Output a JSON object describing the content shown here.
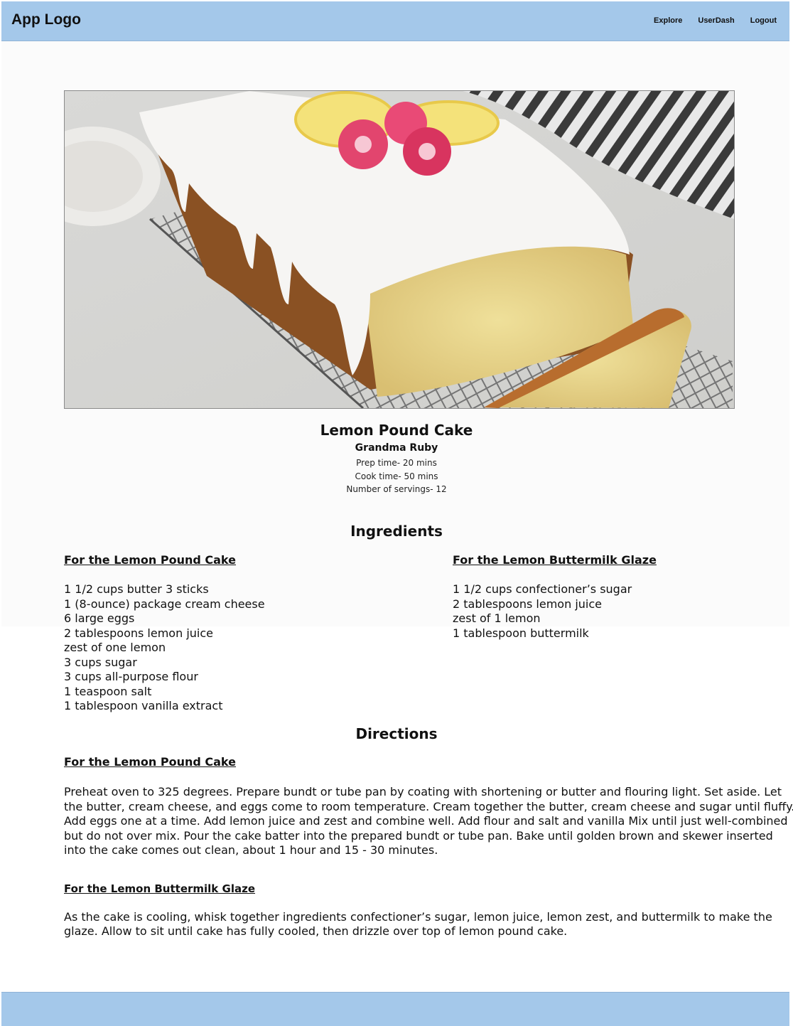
{
  "header": {
    "logo": "App Logo",
    "nav": [
      "Explore",
      "UserDash",
      "Logout"
    ]
  },
  "hero": {
    "image": "lemon-pound-cake-photo"
  },
  "recipe": {
    "title": "Lemon Pound Cake",
    "author": "Grandma Ruby",
    "prep_time": "Prep time- 20 mins",
    "cook_time": "Cook time- 50 mins",
    "servings": "Number of servings- 12"
  },
  "ingredients": {
    "heading": "Ingredients",
    "cake": {
      "title": "For the Lemon Pound Cake",
      "items": [
        "1 1/2 cups butter 3 sticks",
        "1 (8-ounce) package cream cheese",
        "6 large eggs",
        "2 tablespoons lemon juice",
        "zest of one lemon",
        "3 cups sugar",
        "3 cups all-purpose flour",
        "1 teaspoon salt",
        "1 tablespoon vanilla extract"
      ]
    },
    "glaze": {
      "title": "For the Lemon Buttermilk Glaze",
      "items": [
        "1 1/2 cups confectioner’s sugar",
        "2 tablespoons lemon juice",
        "zest of 1 lemon",
        "1 tablespoon buttermilk"
      ]
    }
  },
  "directions": {
    "heading": "Directions",
    "cake": {
      "title": "For the Lemon Pound Cake",
      "text": "Preheat oven to 325 degrees. Prepare bundt or tube pan by coating with shortening or butter and flouring light. Set aside. Let the butter, cream cheese, and eggs come to room temperature. Cream together the butter, cream cheese and sugar until fluffy. Add eggs one at a time. Add lemon juice and zest and combine well. Add flour and salt and vanilla Mix until just well-combined but do not over mix. Pour the cake batter into the prepared bundt or tube pan. Bake until golden brown and skewer inserted into the cake comes out clean, about 1 hour and 15 - 30 minutes."
    },
    "glaze": {
      "title": "For the Lemon Buttermilk Glaze",
      "text": "As the cake is cooling, whisk together ingredients confectioner’s sugar, lemon juice, lemon zest, and buttermilk to make the glaze. Allow to sit until cake has fully cooled, then drizzle over top of lemon pound cake."
    }
  },
  "colors": {
    "header_bg": "#a4c8ea",
    "footer_bg": "#a4c8ea",
    "page_bg": "#fbfbfb"
  }
}
